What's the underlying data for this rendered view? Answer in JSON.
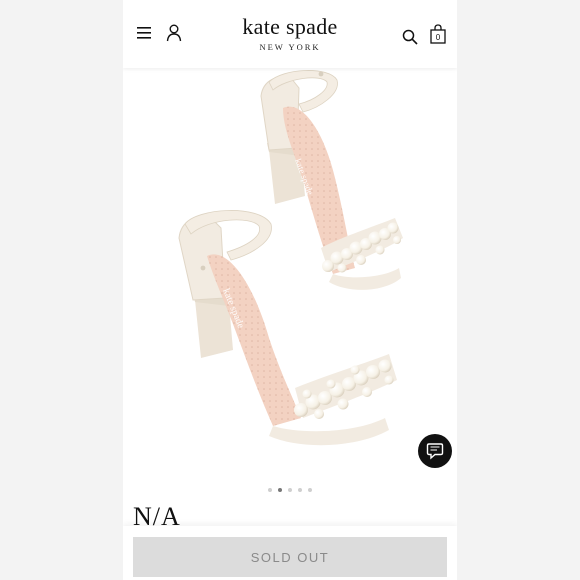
{
  "header": {
    "brand_name": "kate spade",
    "brand_sub": "NEW YORK",
    "bag_count": "0",
    "icons": {
      "menu": "hamburger-menu-icon",
      "account": "user-icon",
      "search": "search-icon",
      "bag": "shopping-bag-icon"
    }
  },
  "product": {
    "name": "N/A",
    "image_alt": "ivory block heel sandals with pearl embellished toe strap",
    "carousel": {
      "count": 5,
      "active_index": 1
    }
  },
  "cta": {
    "label": "SOLD OUT"
  },
  "chat": {
    "icon": "chat-bubble-icon"
  },
  "colors": {
    "accent": "#111111",
    "button_disabled_bg": "#dcdcdc",
    "button_disabled_text": "#8a8a8a",
    "shoe_leather": "#f2ebe1",
    "insole": "#f3d2c2",
    "pearl": "#fbf8f2"
  }
}
